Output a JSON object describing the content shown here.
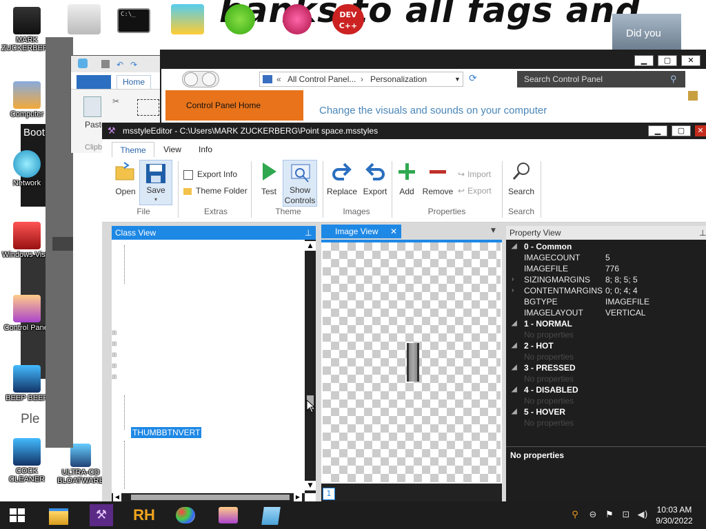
{
  "desktop": {
    "wallpaper_text": "hanks to all fags and",
    "icons": [
      {
        "label": "MARK ZUCKERBERG"
      },
      {
        "label": "Computer"
      },
      {
        "label": "Network"
      },
      {
        "label": "Windows Vista"
      },
      {
        "label": "Control Panel"
      },
      {
        "label": "BEEP BEEP"
      },
      {
        "label": "COCK CLEANER"
      },
      {
        "label": "ULTRA-CD BLOATWARE"
      }
    ],
    "top_icon_dev": "DEV C++",
    "overlay_text": "Did you",
    "side_texts": {
      "boot": "Boot",
      "ples": "Ple"
    }
  },
  "wordpad": {
    "home_tab": "Home",
    "paste_label": "Paste",
    "clipboard_label": "Clipb"
  },
  "control_panel": {
    "breadcrumb": [
      "All Control Panel...",
      "Personalization"
    ],
    "search_placeholder": "Search Control Panel",
    "home_link": "Control Panel Home",
    "heading": "Change the visuals and sounds on your computer"
  },
  "editor": {
    "title": "msstyleEditor - C:\\Users\\MARK ZUCKERBERG\\Point space.msstyles",
    "menu": [
      "Theme",
      "View",
      "Info"
    ],
    "ribbon": {
      "open": "Open",
      "save": "Save",
      "group_file": "File",
      "export_info": "Export Info",
      "theme_folder": "Theme Folder",
      "group_extras": "Extras",
      "test": "Test",
      "show_controls_1": "Show",
      "show_controls_2": "Controls",
      "group_theme": "Theme",
      "replace": "Replace",
      "export": "Export",
      "group_images": "Images",
      "add": "Add",
      "remove": "Remove",
      "import": "Import",
      "export_prop": "Export",
      "group_properties": "Properties",
      "search": "Search",
      "group_search": "Search"
    },
    "class_view": {
      "title": "Class View",
      "selected_node": "THUMBBTNVERT"
    },
    "image_view": {
      "title": "Image View",
      "page_number": "1"
    },
    "property_view": {
      "title": "Property View",
      "footer": "No properties",
      "common_header": "0 - Common",
      "properties": [
        {
          "key": "IMAGECOUNT",
          "value": "5"
        },
        {
          "key": "IMAGEFILE",
          "value": "776"
        },
        {
          "key": "SIZINGMARGINS",
          "value": "8; 8; 5; 5"
        },
        {
          "key": "CONTENTMARGINS",
          "value": "0; 0; 4; 4"
        },
        {
          "key": "BGTYPE",
          "value": "IMAGEFILE"
        },
        {
          "key": "IMAGELAYOUT",
          "value": "VERTICAL"
        }
      ],
      "states": [
        {
          "name": "1 - NORMAL",
          "empty": "No properties"
        },
        {
          "name": "2 - HOT",
          "empty": "No properties"
        },
        {
          "name": "3 - PRESSED",
          "empty": "No properties"
        },
        {
          "name": "4 - DISABLED",
          "empty": "No properties"
        },
        {
          "name": "5 - HOVER",
          "empty": "No properties"
        }
      ]
    }
  },
  "taskbar": {
    "apps": [
      "file-explorer",
      "visual-studio",
      "resource-hacker",
      "paint",
      "control-panel",
      "notepad"
    ],
    "rh_label": "RH",
    "clock_time": "10:03 AM",
    "clock_date": "9/30/2022"
  },
  "colors": {
    "accent_blue": "#1e88e5",
    "orange": "#e8731a",
    "taskbar": "#1d1d1d",
    "property_bg": "#1e1e1e"
  }
}
